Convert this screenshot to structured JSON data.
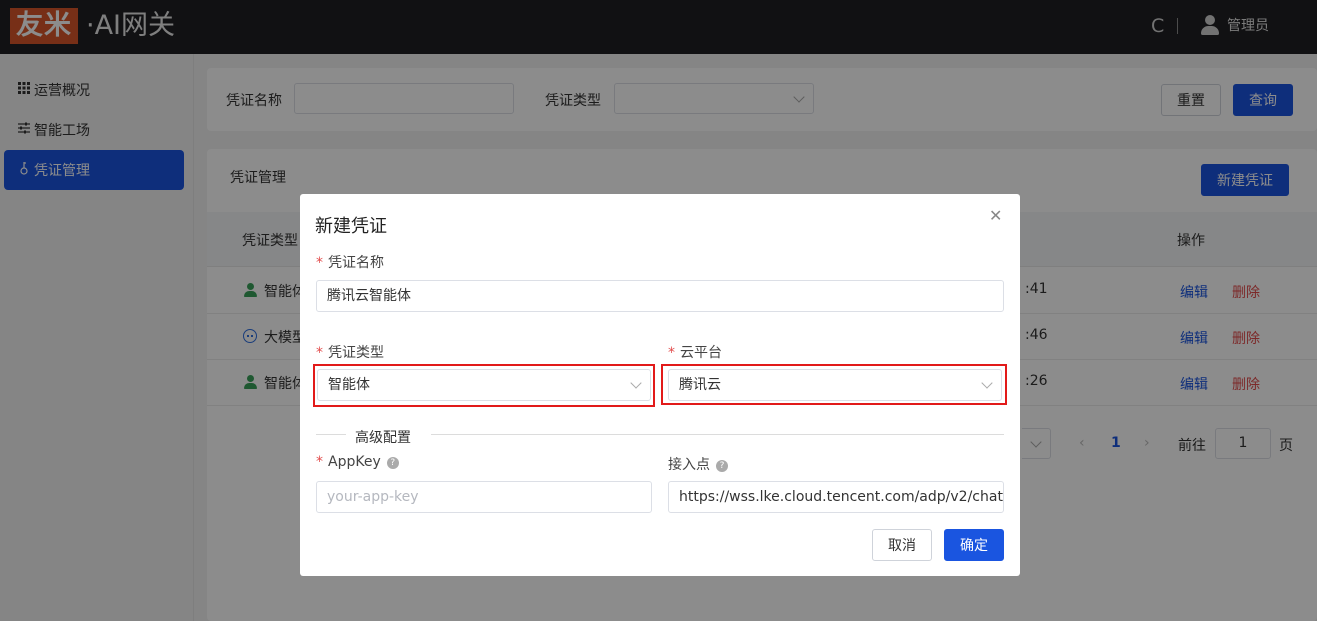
{
  "header": {
    "logo_brand": "友米",
    "logo_product": "·AI网关",
    "refresh_glyph": "C",
    "user_name": "管理员"
  },
  "sidebar": {
    "items": [
      {
        "label": "运营概况",
        "icon": "grid-icon"
      },
      {
        "label": "智能工场",
        "icon": "sliders-icon"
      },
      {
        "label": "凭证管理",
        "icon": "key-icon",
        "active": true
      }
    ]
  },
  "filter": {
    "name_label": "凭证名称",
    "name_value": "",
    "type_label": "凭证类型",
    "type_value": "",
    "reset_label": "重置",
    "query_label": "查询"
  },
  "list": {
    "title": "凭证管理",
    "new_button": "新建凭证",
    "columns": {
      "type": "凭证类型",
      "action": "操作"
    },
    "rows": [
      {
        "type": "智能体",
        "type_icon": "person-icon",
        "time_tail": ":41",
        "edit": "编辑",
        "delete": "删除"
      },
      {
        "type": "大模型",
        "type_icon": "chat-icon",
        "time_tail": ":46",
        "edit": "编辑",
        "delete": "删除"
      },
      {
        "type": "智能体",
        "type_icon": "person-icon",
        "time_tail": ":26",
        "edit": "编辑",
        "delete": "删除"
      }
    ],
    "pager": {
      "current_page": "1",
      "goto_label": "前往",
      "goto_value": "1",
      "page_unit": "页"
    }
  },
  "dialog": {
    "title": "新建凭证",
    "name_label": "凭证名称",
    "name_value": "腾讯云智能体",
    "type_label": "凭证类型",
    "type_value": "智能体",
    "cloud_label": "云平台",
    "cloud_value": "腾讯云",
    "advanced_label": "高级配置",
    "appkey_label": "AppKey",
    "appkey_placeholder": "your-app-key",
    "endpoint_label": "接入点",
    "endpoint_value": "https://wss.lke.cloud.tencent.com/adp/v2/chat",
    "cancel_label": "取消",
    "confirm_label": "确定"
  },
  "colors": {
    "primary": "#1a55e0",
    "danger": "#e24c4c",
    "highlight": "#e21a1a",
    "logo_bg": "#d9572a",
    "topbar_bg": "#1f1f24"
  }
}
